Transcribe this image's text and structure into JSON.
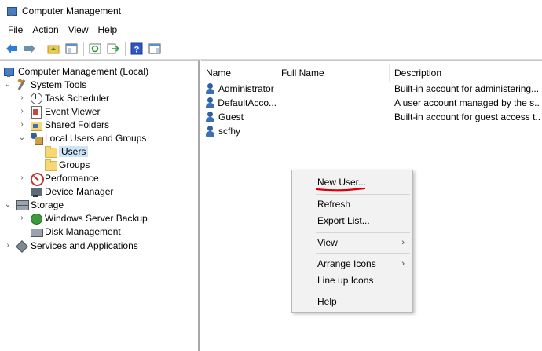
{
  "window": {
    "title": "Computer Management"
  },
  "menu": {
    "file": "File",
    "action": "Action",
    "view": "View",
    "help": "Help"
  },
  "toolbar": {
    "buttons": [
      "back-arrow-icon",
      "forward-arrow-icon",
      "up-folder-icon",
      "show-hide-tree-icon",
      "refresh-icon",
      "export-list-icon",
      "help-icon",
      "show-hide-action-pane-icon"
    ]
  },
  "tree": {
    "root": "Computer Management (Local)",
    "system_tools": "System Tools",
    "task_scheduler": "Task Scheduler",
    "event_viewer": "Event Viewer",
    "shared_folders": "Shared Folders",
    "local_users_groups": "Local Users and Groups",
    "users": "Users",
    "groups": "Groups",
    "performance": "Performance",
    "device_manager": "Device Manager",
    "storage": "Storage",
    "windows_server_backup": "Windows Server Backup",
    "disk_management": "Disk Management",
    "services_apps": "Services and Applications"
  },
  "list": {
    "columns": {
      "name": "Name",
      "full_name": "Full Name",
      "description": "Description"
    },
    "rows": [
      {
        "name": "Administrator",
        "full_name": "",
        "description": "Built-in account for administering..."
      },
      {
        "name": "DefaultAcco...",
        "full_name": "",
        "description": "A user account managed by the s..."
      },
      {
        "name": "Guest",
        "full_name": "",
        "description": "Built-in account for guest access t..."
      },
      {
        "name": "scfhy",
        "full_name": "",
        "description": ""
      }
    ]
  },
  "context_menu": {
    "new_user": "New User...",
    "refresh": "Refresh",
    "export_list": "Export List...",
    "view": "View",
    "arrange_icons": "Arrange Icons",
    "line_up_icons": "Line up Icons",
    "help": "Help",
    "submenu_arrow": "›"
  },
  "colors": {
    "selection": "#cce4f7",
    "annotation_underline": "#d4000c",
    "menu_bg": "#f2f2f2"
  }
}
